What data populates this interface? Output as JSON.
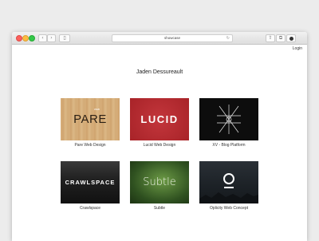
{
  "browser": {
    "address": "showcase",
    "nav_back": "‹",
    "nav_forward": "›",
    "reload": "↻",
    "share": "⇧",
    "tabs": "⧉",
    "sidebar": "▯"
  },
  "page": {
    "login": "Login",
    "title": "Jaden Dessureault"
  },
  "projects": [
    {
      "caption": "Pare Web Design",
      "logo_text": "PARE",
      "small_text": "WEB"
    },
    {
      "caption": "Lucid Web Design",
      "logo_text": "LUCID"
    },
    {
      "caption": "XV - Blog Platform"
    },
    {
      "caption": "Crawlspace",
      "logo_text": "CRAWLSPACE"
    },
    {
      "caption": "Subtle",
      "logo_text": "Subtle"
    },
    {
      "caption": "Oplicity Web Concept"
    }
  ],
  "colors": {
    "lucid_bg": "#b22a2f",
    "pare_bg": "#d6ac77",
    "dark_bg": "#111111",
    "subtle_bg": "#4f7a33"
  }
}
